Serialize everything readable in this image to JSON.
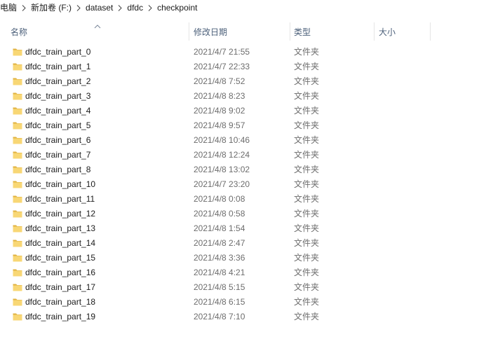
{
  "breadcrumb": {
    "items": [
      "电脑",
      "新加卷 (F:)",
      "dataset",
      "dfdc",
      "checkpoint"
    ]
  },
  "columns": {
    "name": "名称",
    "date": "修改日期",
    "type": "类型",
    "size": "大小"
  },
  "icons": {
    "sort": "sort-ascending-chevron-icon",
    "separator": "chevron-right-icon",
    "folder": "folder-icon"
  },
  "colors": {
    "folder_body": "#f8d775",
    "folder_tab": "#e0b240",
    "header_text": "#4c607a",
    "secondary_text": "#6d6d6d"
  },
  "files": [
    {
      "name": "dfdc_train_part_0",
      "date": "2021/4/7 21:55",
      "type": "文件夹",
      "size": ""
    },
    {
      "name": "dfdc_train_part_1",
      "date": "2021/4/7 22:33",
      "type": "文件夹",
      "size": ""
    },
    {
      "name": "dfdc_train_part_2",
      "date": "2021/4/8 7:52",
      "type": "文件夹",
      "size": ""
    },
    {
      "name": "dfdc_train_part_3",
      "date": "2021/4/8 8:23",
      "type": "文件夹",
      "size": ""
    },
    {
      "name": "dfdc_train_part_4",
      "date": "2021/4/8 9:02",
      "type": "文件夹",
      "size": ""
    },
    {
      "name": "dfdc_train_part_5",
      "date": "2021/4/8 9:57",
      "type": "文件夹",
      "size": ""
    },
    {
      "name": "dfdc_train_part_6",
      "date": "2021/4/8 10:46",
      "type": "文件夹",
      "size": ""
    },
    {
      "name": "dfdc_train_part_7",
      "date": "2021/4/8 12:24",
      "type": "文件夹",
      "size": ""
    },
    {
      "name": "dfdc_train_part_8",
      "date": "2021/4/8 13:02",
      "type": "文件夹",
      "size": ""
    },
    {
      "name": "dfdc_train_part_10",
      "date": "2021/4/7 23:20",
      "type": "文件夹",
      "size": ""
    },
    {
      "name": "dfdc_train_part_11",
      "date": "2021/4/8 0:08",
      "type": "文件夹",
      "size": ""
    },
    {
      "name": "dfdc_train_part_12",
      "date": "2021/4/8 0:58",
      "type": "文件夹",
      "size": ""
    },
    {
      "name": "dfdc_train_part_13",
      "date": "2021/4/8 1:54",
      "type": "文件夹",
      "size": ""
    },
    {
      "name": "dfdc_train_part_14",
      "date": "2021/4/8 2:47",
      "type": "文件夹",
      "size": ""
    },
    {
      "name": "dfdc_train_part_15",
      "date": "2021/4/8 3:36",
      "type": "文件夹",
      "size": ""
    },
    {
      "name": "dfdc_train_part_16",
      "date": "2021/4/8 4:21",
      "type": "文件夹",
      "size": ""
    },
    {
      "name": "dfdc_train_part_17",
      "date": "2021/4/8 5:15",
      "type": "文件夹",
      "size": ""
    },
    {
      "name": "dfdc_train_part_18",
      "date": "2021/4/8 6:15",
      "type": "文件夹",
      "size": ""
    },
    {
      "name": "dfdc_train_part_19",
      "date": "2021/4/8 7:10",
      "type": "文件夹",
      "size": ""
    }
  ]
}
